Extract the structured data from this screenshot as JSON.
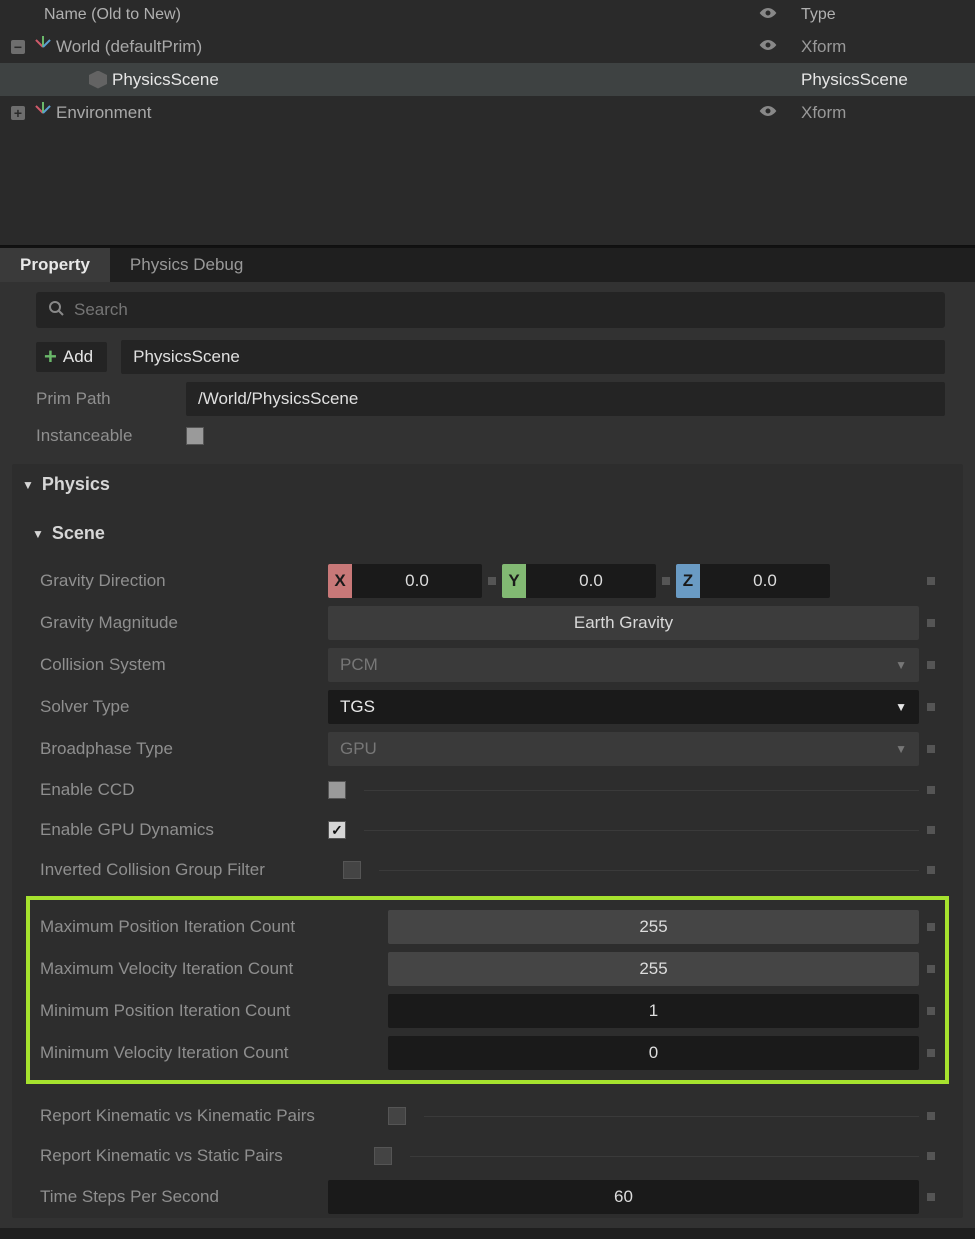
{
  "outliner": {
    "header_name": "Name (Old to New)",
    "header_type": "Type",
    "rows": [
      {
        "toggle": "-",
        "name": "World (defaultPrim)",
        "type": "Xform",
        "icon": "axis",
        "eye": true,
        "indent": 0
      },
      {
        "toggle": "",
        "name": "PhysicsScene",
        "type": "PhysicsScene",
        "icon": "cube",
        "eye": false,
        "indent": 1,
        "selected": true
      },
      {
        "toggle": "+",
        "name": "Environment",
        "type": "Xform",
        "icon": "axis",
        "eye": true,
        "indent": 0
      }
    ]
  },
  "tabs": {
    "property": "Property",
    "physics_debug": "Physics Debug"
  },
  "search_placeholder": "Search",
  "add_label": "Add",
  "prim_name": "PhysicsScene",
  "prim_path_label": "Prim Path",
  "prim_path": "/World/PhysicsScene",
  "instanceable_label": "Instanceable",
  "section_physics": "Physics",
  "section_scene": "Scene",
  "fields": {
    "gravity_direction_label": "Gravity Direction",
    "gravity_direction": {
      "x": "0.0",
      "y": "0.0",
      "z": "0.0"
    },
    "gravity_magnitude_label": "Gravity Magnitude",
    "gravity_magnitude_btn": "Earth Gravity",
    "collision_system_label": "Collision System",
    "collision_system": "PCM",
    "solver_type_label": "Solver Type",
    "solver_type": "TGS",
    "broadphase_label": "Broadphase Type",
    "broadphase": "GPU",
    "enable_ccd_label": "Enable CCD",
    "enable_gpu_label": "Enable GPU Dynamics",
    "inverted_filter_label": "Inverted Collision Group Filter",
    "max_pos_label": "Maximum Position Iteration Count",
    "max_pos": "255",
    "max_vel_label": "Maximum Velocity Iteration Count",
    "max_vel": "255",
    "min_pos_label": "Minimum Position Iteration Count",
    "min_pos": "1",
    "min_vel_label": "Minimum Velocity Iteration Count",
    "min_vel": "0",
    "report_kk_label": "Report Kinematic vs Kinematic Pairs",
    "report_ks_label": "Report Kinematic vs Static Pairs",
    "tsps_label": "Time Steps Per Second",
    "tsps": "60"
  }
}
